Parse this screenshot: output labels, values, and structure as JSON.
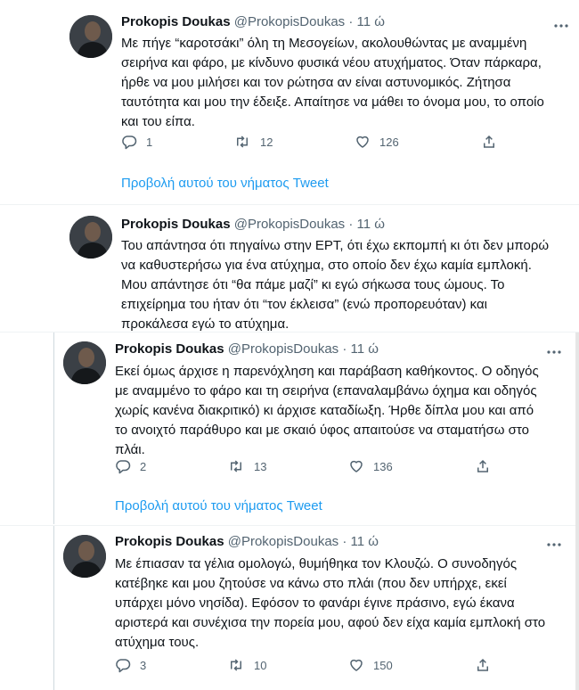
{
  "tweets": [
    {
      "name": "Prokopis Doukas",
      "handle": "@ProkopisDoukas",
      "dot": "·",
      "time": "11 ώ",
      "lines": [
        "Με πήγε “καροτσάκι” όλη τη Μεσογείων, ακολουθώντας με αναμμένη",
        "σειρήνα και φάρο, με κίνδυνο φυσικά νέου ατυχήματος. Όταν πάρκαρα,",
        "ήρθε να μου μιλήσει και τον ρώτησα αν είναι αστυνομικός. Ζήτησα",
        "ταυτότητα και μου την έδειξε. Απαίτησε να μάθει το όνομα μου, το οποίο",
        "και του είπα."
      ],
      "replies": "1",
      "retweets": "12",
      "likes": "126",
      "thread_link": "Προβολή αυτού του νήματος Tweet"
    },
    {
      "name": "Prokopis Doukas",
      "handle": "@ProkopisDoukas",
      "dot": "·",
      "time": "11 ώ",
      "lines": [
        "Του απάντησα ότι πηγαίνω στην ΕΡΤ, ότι έχω εκπομπή κι ότι δεν μπορώ",
        "να καθυστερήσω για ένα ατύχημα, στο οποίο δεν έχω καμία εμπλοκή.",
        "Μου απάντησε ότι “θα πάμε μαζί” κι εγώ σήκωσα τους ώμους. Το",
        "επιχείρημα του ήταν ότι “τον έκλεισα” (ενώ προπορευόταν) και",
        "προκάλεσα εγώ το ατύχημα."
      ]
    },
    {
      "name": "Prokopis Doukas",
      "handle": "@ProkopisDoukas",
      "dot": "·",
      "time": "11 ώ",
      "lines": [
        "Εκεί όμως άρχισε η παρενόχληση και παράβαση καθήκοντος. Ο οδηγός",
        "με αναμμένο το φάρο και τη σειρήνα (επαναλαμβάνω όχημα και οδηγός",
        "χωρίς κανένα διακριτικό) κι άρχισε καταδίωξη. Ήρθε δίπλα μου και από",
        "το ανοιχτό παράθυρο και με σκαιό ύφος απαιτούσε να σταματήσω στο",
        "πλάι."
      ],
      "replies": "2",
      "retweets": "13",
      "likes": "136",
      "thread_link": "Προβολή αυτού του νήματος Tweet"
    },
    {
      "name": "Prokopis Doukas",
      "handle": "@ProkopisDoukas",
      "dot": "·",
      "time": "11 ώ",
      "lines": [
        "Με έπιασαν τα γέλια ομολογώ, θυμήθηκα τον Κλουζώ. Ο συνοδηγός",
        "κατέβηκε και μου ζητούσε να κάνω στο πλάι (που δεν υπήρχε, εκεί",
        "υπάρχει μόνο νησίδα). Εφόσον το φανάρι έγινε πράσινο, εγώ έκανα",
        "αριστερά και συνέχισα την πορεία μου, αφού δεν είχα καμία εμπλοκή στο",
        "ατύχημα τους."
      ],
      "replies": "3",
      "retweets": "10",
      "likes": "150"
    }
  ],
  "icons": {
    "reply": "reply-icon",
    "retweet": "retweet-icon",
    "like": "heart-icon",
    "share": "share-icon",
    "more": "more-icon"
  },
  "colors": {
    "text": "#0f1419",
    "secondary": "#536471",
    "link": "#1d9bf0"
  }
}
